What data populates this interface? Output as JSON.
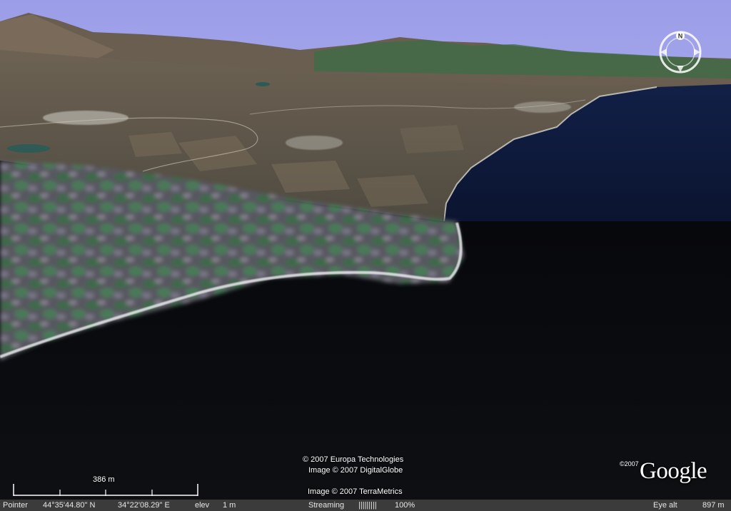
{
  "credits": {
    "line1": "© 2007 Europa Technologies",
    "line2": "Image © 2007 DigitalGlobe",
    "line3": "Image © 2007 TerraMetrics"
  },
  "logo": {
    "copyright": "©2007",
    "word": "Google"
  },
  "scale": {
    "label": "386 m"
  },
  "compass": {
    "north_label": "N",
    "icon": "compass-icon"
  },
  "status": {
    "pointer_label": "Pointer",
    "lat": "44°35'44.80\" N",
    "lon": "34°22'08.29\" E",
    "elev_label": "elev",
    "elev_value": "1 m",
    "streaming_label": "Streaming",
    "streaming_bar": "|||||||||",
    "streaming_pct": "100%",
    "eye_alt_label": "Eye alt",
    "eye_alt_value": "897 m"
  },
  "colors": {
    "sky": "#9a9ce6",
    "sea": "#0d1630",
    "land": "#5b5346",
    "vegetation": "#3d6a48"
  }
}
